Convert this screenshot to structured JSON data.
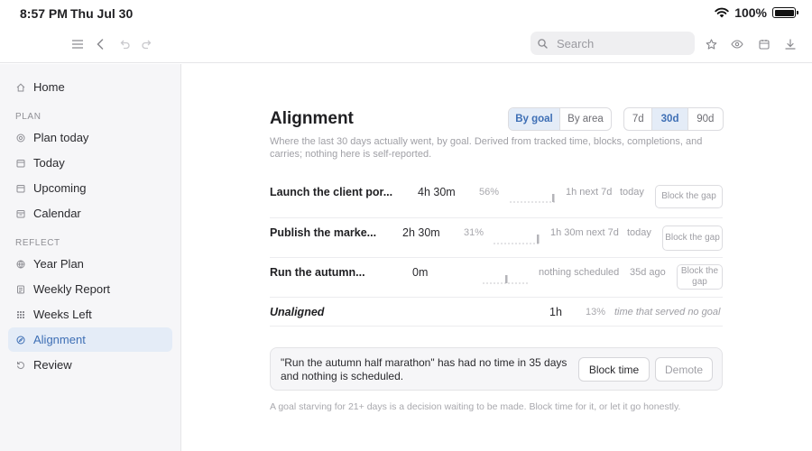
{
  "status": {
    "time": "8:57 PM",
    "date": "Thu Jul 30",
    "battery": "100%"
  },
  "toolbar": {
    "search_placeholder": "Search"
  },
  "sidebar": {
    "items_top": [
      {
        "label": "Home",
        "icon": "home-icon"
      }
    ],
    "plan_label": "PLAN",
    "plan_items": [
      {
        "label": "Plan today",
        "icon": "target-icon"
      },
      {
        "label": "Today",
        "icon": "calendar-icon"
      },
      {
        "label": "Upcoming",
        "icon": "calendar-icon"
      },
      {
        "label": "Calendar",
        "icon": "calendar-icon"
      }
    ],
    "reflect_label": "REFLECT",
    "reflect_items": [
      {
        "label": "Year Plan",
        "icon": "globe-icon"
      },
      {
        "label": "Weekly Report",
        "icon": "report-icon"
      },
      {
        "label": "Weeks Left",
        "icon": "grid-icon"
      },
      {
        "label": "Alignment",
        "icon": "compass-icon",
        "active": true
      },
      {
        "label": "Review",
        "icon": "refresh-icon"
      }
    ]
  },
  "main": {
    "title": "Alignment",
    "group_toggle": {
      "options": [
        "By goal",
        "By area"
      ],
      "selected": "By goal"
    },
    "range_toggle": {
      "options": [
        "7d",
        "30d",
        "90d"
      ],
      "selected": "30d"
    },
    "subtitle": "Where the last 30 days actually went, by goal. Derived from tracked time, blocks, completions, and carries; nothing here is self-reported.",
    "rows": [
      {
        "name": "Launch the client por...",
        "hours": "4h 30m",
        "pct": "56%",
        "next": "1h next 7d",
        "ago": "today",
        "button": "Block the gap",
        "bar_level": 0.55
      },
      {
        "name": "Publish the marke...",
        "hours": "2h 30m",
        "pct": "31%",
        "next": "1h 30m next 7d",
        "ago": "today",
        "button": "Block the gap",
        "bar_level": 0.6
      },
      {
        "name": "Run the autumn...",
        "hours": "0m",
        "pct": "",
        "next": "nothing scheduled",
        "ago": "35d ago",
        "button": "Block the gap",
        "bar_level": 0.55
      }
    ],
    "unaligned": {
      "name": "Unaligned",
      "hours": "1h",
      "pct": "13%",
      "note": "time that served no goal"
    },
    "callout": {
      "message": "\"Run the autumn half marathon\" has had no time in 35 days and nothing is scheduled.",
      "primary_button": "Block time",
      "secondary_button": "Demote"
    },
    "footnote": "A goal starving for 21+ days is a decision waiting to be made. Block time for it, or let it go honestly."
  },
  "colors": {
    "accent": "#3e6fb5",
    "accent_bg": "#e4ecf7",
    "sidebar_bg": "#f6f6f8"
  }
}
